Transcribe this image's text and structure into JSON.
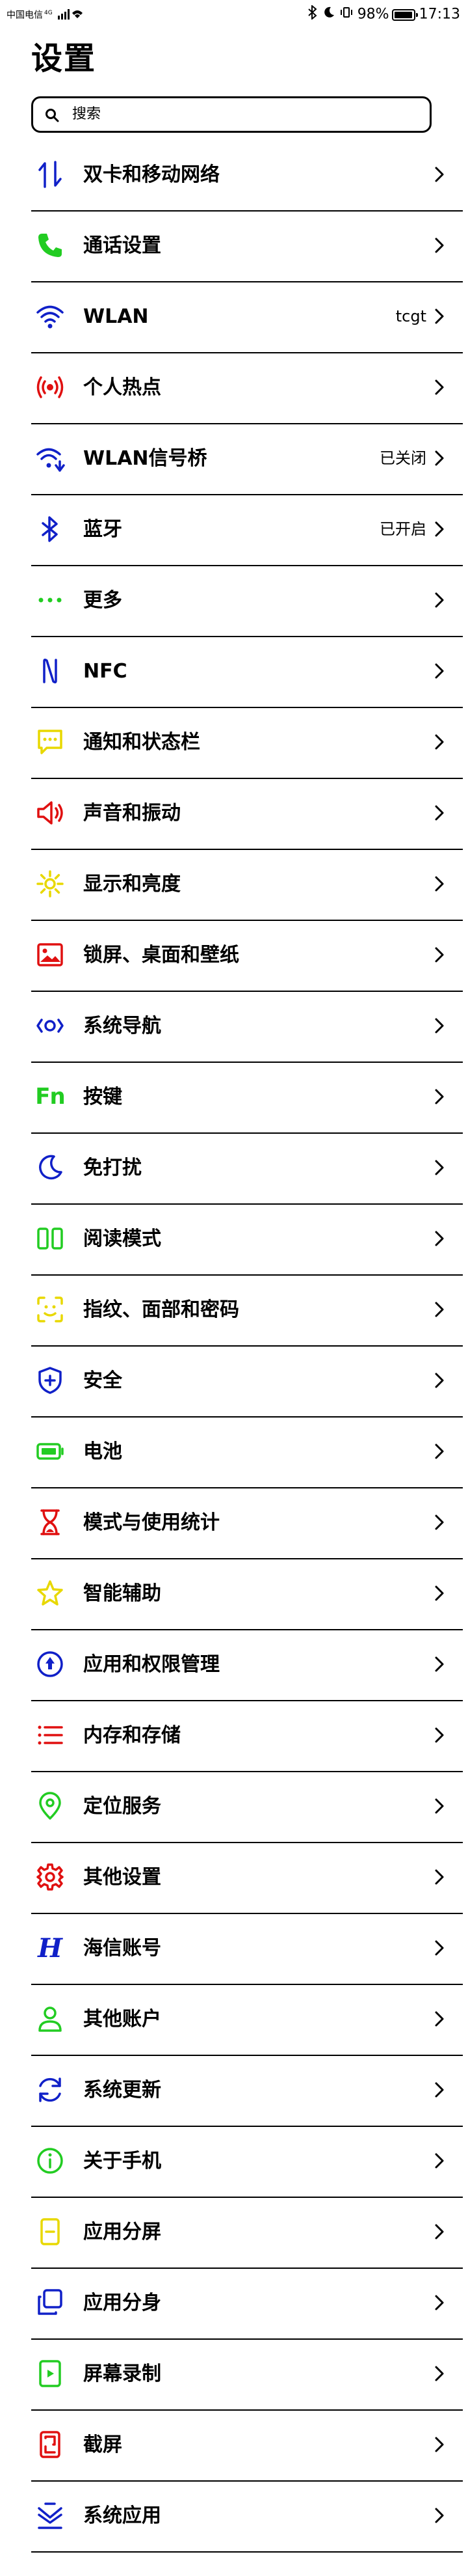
{
  "status_bar": {
    "carrier": "中国电信",
    "network": "4G",
    "battery_text": "98%",
    "battery_level": 0.98,
    "time": "17:13"
  },
  "page_title": "设置",
  "search": {
    "placeholder": "搜索"
  },
  "items": [
    {
      "label": "双卡和移动网络",
      "value": "",
      "icon": "dual-sim-arrows-icon",
      "color": "#1020c8"
    },
    {
      "label": "通话设置",
      "value": "",
      "icon": "phone-icon",
      "color": "#22cc22"
    },
    {
      "label": "WLAN",
      "value": "tcgt",
      "icon": "wifi-icon",
      "color": "#1020c8"
    },
    {
      "label": "个人热点",
      "value": "",
      "icon": "hotspot-icon",
      "color": "#e01010"
    },
    {
      "label": "WLAN信号桥",
      "value": "已关闭",
      "icon": "wifi-bridge-icon",
      "color": "#1020c8"
    },
    {
      "label": "蓝牙",
      "value": "已开启",
      "icon": "bluetooth-icon",
      "color": "#1020c8"
    },
    {
      "label": "更多",
      "value": "",
      "icon": "more-dots-icon",
      "color": "#22cc22"
    },
    {
      "label": "NFC",
      "value": "",
      "icon": "nfc-icon",
      "color": "#1020c8"
    },
    {
      "label": "通知和状态栏",
      "value": "",
      "icon": "notification-icon",
      "color": "#e8d800"
    },
    {
      "label": "声音和振动",
      "value": "",
      "icon": "speaker-icon",
      "color": "#e01010"
    },
    {
      "label": "显示和亮度",
      "value": "",
      "icon": "brightness-icon",
      "color": "#e8d800"
    },
    {
      "label": "锁屏、桌面和壁纸",
      "value": "",
      "icon": "wallpaper-icon",
      "color": "#e01010"
    },
    {
      "label": "系统导航",
      "value": "",
      "icon": "navigation-icon",
      "color": "#1020c8"
    },
    {
      "label": "按键",
      "value": "",
      "icon": "fn-key-icon",
      "color": "#22cc22",
      "glyph": "Fn"
    },
    {
      "label": "免打扰",
      "value": "",
      "icon": "moon-icon",
      "color": "#1020c8"
    },
    {
      "label": "阅读模式",
      "value": "",
      "icon": "reading-mode-icon",
      "color": "#22cc22"
    },
    {
      "label": "指纹、面部和密码",
      "value": "",
      "icon": "face-scan-icon",
      "color": "#e8d800"
    },
    {
      "label": "安全",
      "value": "",
      "icon": "shield-icon",
      "color": "#1020c8"
    },
    {
      "label": "电池",
      "value": "",
      "icon": "battery-icon",
      "color": "#22cc22"
    },
    {
      "label": "模式与使用统计",
      "value": "",
      "icon": "hourglass-icon",
      "color": "#e01010"
    },
    {
      "label": "智能辅助",
      "value": "",
      "icon": "star-icon",
      "color": "#e8d800"
    },
    {
      "label": "应用和权限管理",
      "value": "",
      "icon": "app-permission-icon",
      "color": "#1020c8"
    },
    {
      "label": "内存和存储",
      "value": "",
      "icon": "storage-list-icon",
      "color": "#e01010"
    },
    {
      "label": "定位服务",
      "value": "",
      "icon": "location-pin-icon",
      "color": "#22cc22"
    },
    {
      "label": "其他设置",
      "value": "",
      "icon": "gear-icon",
      "color": "#e01010"
    },
    {
      "label": "海信账号",
      "value": "",
      "icon": "hisense-logo-icon",
      "color": "#1020c8",
      "glyph": "H"
    },
    {
      "label": "其他账户",
      "value": "",
      "icon": "user-icon",
      "color": "#22cc22"
    },
    {
      "label": "系统更新",
      "value": "",
      "icon": "refresh-icon",
      "color": "#1020c8"
    },
    {
      "label": "关于手机",
      "value": "",
      "icon": "info-icon",
      "color": "#22cc22"
    },
    {
      "label": "应用分屏",
      "value": "",
      "icon": "split-screen-icon",
      "color": "#e8d800"
    },
    {
      "label": "应用分身",
      "value": "",
      "icon": "app-clone-icon",
      "color": "#1020c8"
    },
    {
      "label": "屏幕录制",
      "value": "",
      "icon": "screen-record-icon",
      "color": "#22cc22"
    },
    {
      "label": "截屏",
      "value": "",
      "icon": "screenshot-icon",
      "color": "#e01010"
    },
    {
      "label": "系统应用",
      "value": "",
      "icon": "system-apps-icon",
      "color": "#1020c8"
    }
  ]
}
